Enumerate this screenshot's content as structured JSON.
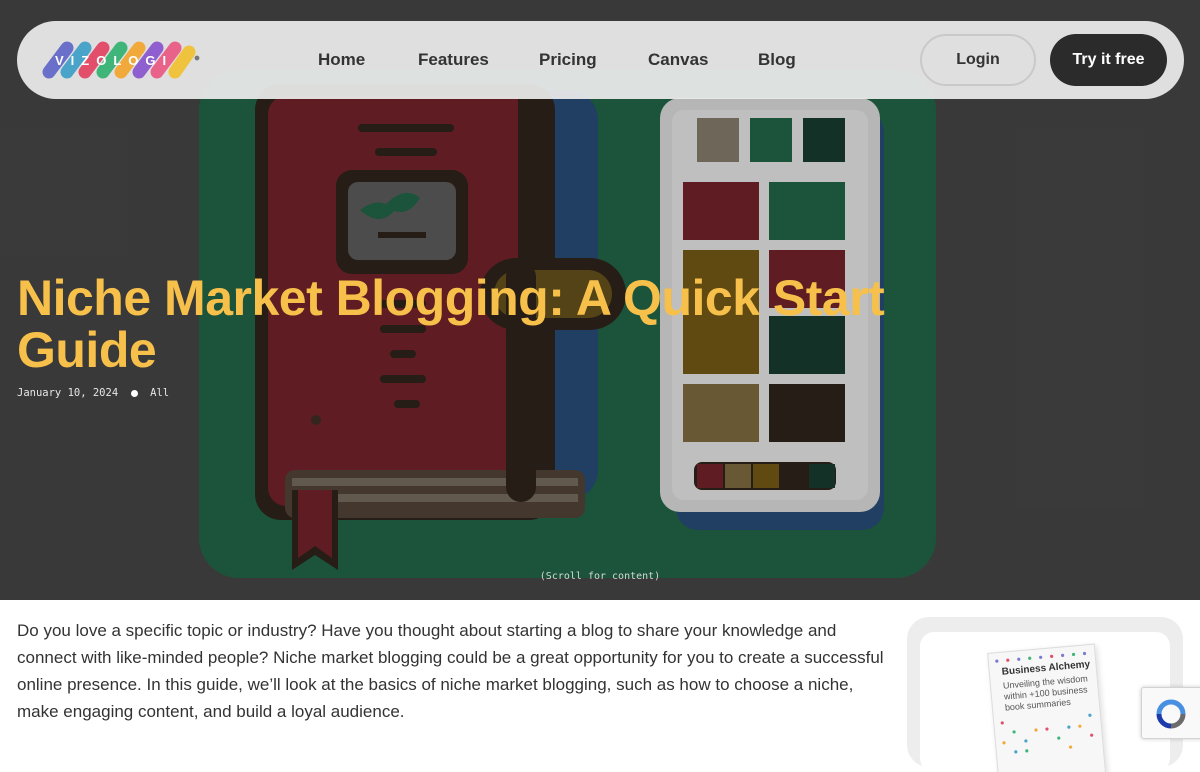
{
  "nav": {
    "logo_text": "VIZOLOGI",
    "links": [
      "Home",
      "Features",
      "Pricing",
      "Canvas",
      "Blog"
    ],
    "login_label": "Login",
    "cta_label": "Try it free"
  },
  "hero": {
    "title": "Niche Market Blogging: A Quick Start Guide",
    "date": "January 10, 2024",
    "category": "All",
    "scroll_hint": "(Scroll for content)"
  },
  "article": {
    "intro": "Do you love a specific topic or industry? Have you thought about starting a blog to share your knowledge and connect with like-minded people? Niche market blogging could be a great opportunity for you to create a successful online presence. In this guide, we’ll look at the basics of niche market blogging, such as how to choose a niche, make engaging content, and build a loyal audience."
  },
  "sidebar": {
    "book_title": "Business Alchemy",
    "book_subtitle": "Unveiling the wisdom within +100 business book summaries"
  },
  "colors": {
    "title": "#f7c04a",
    "cta_bg": "#2b2b2b",
    "nav_bg": "#ececec",
    "hero_bg": "#3f3f3f"
  },
  "icons": [
    "vizologi-logo",
    "recaptcha-icon",
    "notebook-illustration",
    "color-palette-illustration"
  ]
}
